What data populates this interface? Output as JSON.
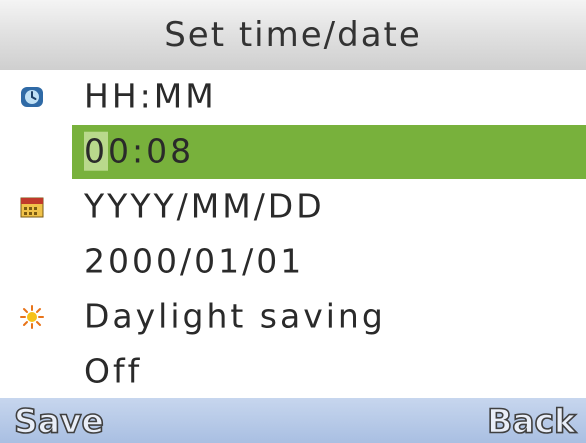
{
  "title": "Set time/date",
  "items": [
    {
      "icon": "clock-icon",
      "label": "HH:MM"
    },
    {
      "value_cursor": "0",
      "value_rest": "0:08"
    },
    {
      "icon": "calendar-icon",
      "label": "YYYY/MM/DD"
    },
    {
      "value": "2000/01/01"
    },
    {
      "icon": "sun-icon",
      "label": "Daylight saving"
    },
    {
      "value": "Off"
    }
  ],
  "softkeys": {
    "left": "Save",
    "right": "Back"
  },
  "colors": {
    "highlight": "#78b13c",
    "softbar": "#b4c8e8",
    "sun": "#f2a81d",
    "calendar": "#c0392b"
  }
}
